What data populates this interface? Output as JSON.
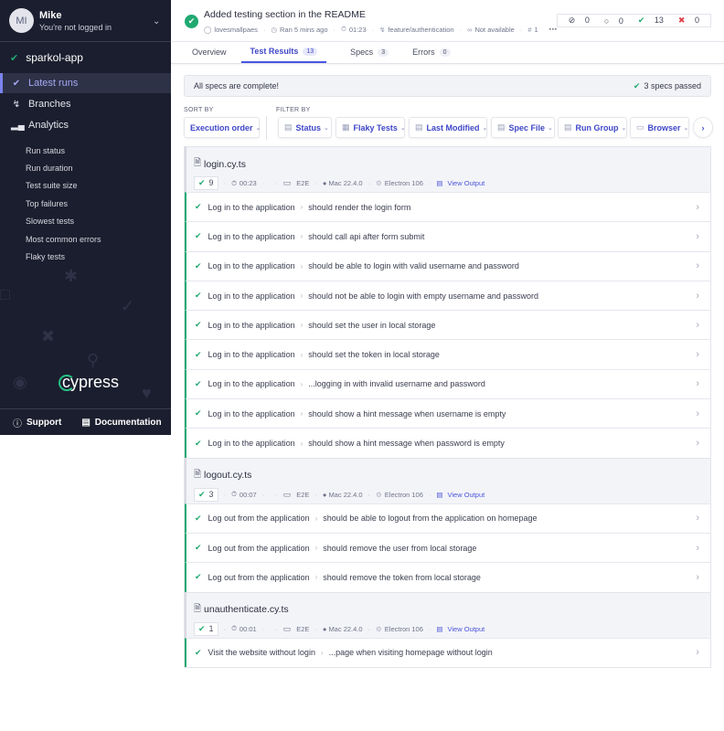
{
  "sidebar": {
    "user": {
      "initials": "MI",
      "name": "Mike",
      "status": "You're not logged in"
    },
    "project": "sparkol-app",
    "nav": [
      {
        "label": "Latest runs",
        "icon": "check-circle-icon",
        "active": true
      },
      {
        "label": "Branches",
        "icon": "branch-icon",
        "active": false
      },
      {
        "label": "Analytics",
        "icon": "bar-chart-icon",
        "active": false
      }
    ],
    "analytics_items": [
      "Run status",
      "Run duration",
      "Test suite size",
      "Top failures",
      "Slowest tests",
      "Most common errors",
      "Flaky tests"
    ],
    "logo": "cypress",
    "footer": {
      "support": "Support",
      "documentation": "Documentation"
    }
  },
  "header": {
    "title": "Added testing section in the README",
    "author": "lovesmallpaes",
    "ran": "Ran 5 mins ago",
    "duration": "01:23",
    "branch": "feature/authentication",
    "pr": "Not available",
    "run_number": "1",
    "counts": {
      "skipped": "0",
      "pending": "0",
      "passed": "13",
      "failed": "0"
    }
  },
  "tabs": [
    {
      "label": "Overview",
      "count": null
    },
    {
      "label": "Test Results",
      "count": "13",
      "active": true
    },
    {
      "label": "Specs",
      "count": "3"
    },
    {
      "label": "Errors",
      "count": "0"
    }
  ],
  "banner": {
    "message": "All specs are complete!",
    "passed": "3 specs passed"
  },
  "sort": {
    "label": "SORT BY",
    "value": "Execution order"
  },
  "filter": {
    "label": "FILTER BY",
    "buttons": [
      "Status",
      "Flaky Tests",
      "Last Modified",
      "Spec File",
      "Run Group",
      "Browser"
    ]
  },
  "specs": [
    {
      "name": "login.cy.ts",
      "passed": "9",
      "duration": "00:23",
      "type": "E2E",
      "os": "Mac 22.4.0",
      "browser": "Electron 106",
      "output": "View Output",
      "tests": [
        {
          "suite": "Log in to the application",
          "title": "should render the login form"
        },
        {
          "suite": "Log in to the application",
          "title": "should call api after form submit"
        },
        {
          "suite": "Log in to the application",
          "title": "should be able to login with valid username and password"
        },
        {
          "suite": "Log in to the application",
          "title": "should not be able to login with empty username and password"
        },
        {
          "suite": "Log in to the application",
          "title": "should set the user in local storage"
        },
        {
          "suite": "Log in to the application",
          "title": "should set the token in local storage"
        },
        {
          "suite": "Log in to the application",
          "title": "...logging in with invalid username and password"
        },
        {
          "suite": "Log in to the application",
          "title": "should show a hint message when username is empty"
        },
        {
          "suite": "Log in to the application",
          "title": "should show a hint message when password is empty"
        }
      ]
    },
    {
      "name": "logout.cy.ts",
      "passed": "3",
      "duration": "00:07",
      "type": "E2E",
      "os": "Mac 22.4.0",
      "browser": "Electron 106",
      "output": "View Output",
      "tests": [
        {
          "suite": "Log out from the application",
          "title": "should be able to logout from the application on homepage"
        },
        {
          "suite": "Log out from the application",
          "title": "should remove the user from local storage"
        },
        {
          "suite": "Log out from the application",
          "title": "should remove the token from local storage"
        }
      ]
    },
    {
      "name": "unauthenticate.cy.ts",
      "passed": "1",
      "duration": "00:01",
      "type": "E2E",
      "os": "Mac 22.4.0",
      "browser": "Electron 106",
      "output": "View Output",
      "tests": [
        {
          "suite": "Visit the website without login",
          "title": "...page when visiting homepage without login"
        }
      ]
    }
  ]
}
